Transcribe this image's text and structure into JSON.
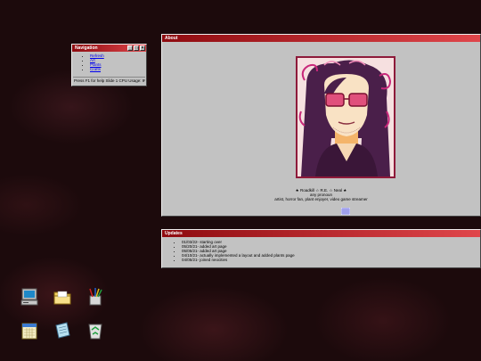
{
  "nav_window": {
    "title": "Navigation",
    "links": [
      "Refresh",
      "Art",
      "Plants",
      "Crafts"
    ],
    "status": "Press F1 for help  Slide 1  CPU Usage: 9%"
  },
  "about_window": {
    "title": "About",
    "name_line": "★ Roadkill ☆ R.E. ☆ Neal ★",
    "pronouns": "any pronoun",
    "description": "artist, horror fan, plant enjoyer, video game streamer",
    "badge_icon": "grid-badge-icon"
  },
  "updates_window": {
    "title": "Updates",
    "items": [
      "01/03/22- starting over",
      "05/20/21- added art page",
      "05/05/21- added art page",
      "04/10/21- actually implemented a layout and added plants page",
      "04/05/21- joined neocities"
    ]
  },
  "desktop_icons": [
    {
      "name": "computer-icon"
    },
    {
      "name": "folder-icon"
    },
    {
      "name": "paint-supplies-icon"
    },
    {
      "name": "calendar-icon"
    },
    {
      "name": "notepad-icon"
    },
    {
      "name": "recycle-bin-icon"
    }
  ],
  "colors": {
    "titlebar_start": "#8e0b10",
    "titlebar_end": "#e0464b",
    "window_bg": "#c2c2c2"
  }
}
